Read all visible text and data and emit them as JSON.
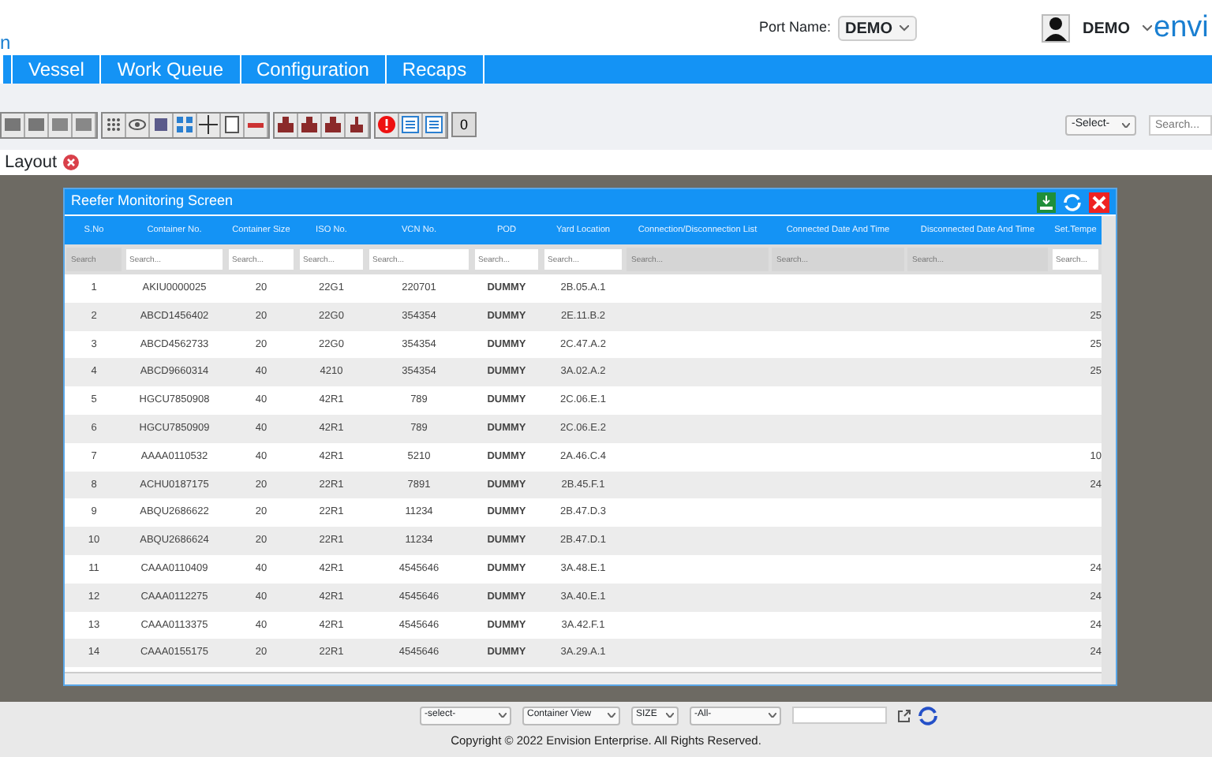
{
  "header": {
    "app_title_fragment": "n",
    "port_label": "Port Name:",
    "port_value": "DEMO",
    "user_name": "DEMO",
    "logo_text": "envi"
  },
  "nav": {
    "items": [
      {
        "label": "Vessel",
        "selected": false
      },
      {
        "label": "Work Queue",
        "selected": false
      },
      {
        "label": "Configuration",
        "selected": false
      },
      {
        "label": "Recaps",
        "selected": false
      }
    ]
  },
  "toolbar": {
    "count": "0",
    "select_value": "-Select-",
    "search_placeholder": "Search..."
  },
  "layout_tab": {
    "label": "Layout"
  },
  "reefer_window": {
    "title": "Reefer Monitoring Screen",
    "columns": [
      "S.No",
      "Container No.",
      "Container Size",
      "ISO No.",
      "VCN No.",
      "POD",
      "Yard Location",
      "Connection/Disconnection List",
      "Connected Date And Time",
      "Disconnected Date And Time",
      "Set.Tempe"
    ],
    "filter_placeholders": [
      "Search",
      "Search...",
      "Search...",
      "Search...",
      "Search...",
      "Search...",
      "Search...",
      "Search...",
      "Search...",
      "Search...",
      "Search..."
    ],
    "rows": [
      [
        "1",
        "AKIU0000025",
        "20",
        "22G1",
        "220701",
        "DUMMY",
        "2B.05.A.1",
        "",
        "",
        "",
        ""
      ],
      [
        "2",
        "ABCD1456402",
        "20",
        "22G0",
        "354354",
        "DUMMY",
        "2E.11.B.2",
        "",
        "",
        "",
        "25"
      ],
      [
        "3",
        "ABCD4562733",
        "20",
        "22G0",
        "354354",
        "DUMMY",
        "2C.47.A.2",
        "",
        "",
        "",
        "25"
      ],
      [
        "4",
        "ABCD9660314",
        "40",
        "4210",
        "354354",
        "DUMMY",
        "3A.02.A.2",
        "",
        "",
        "",
        "25"
      ],
      [
        "5",
        "HGCU7850908",
        "40",
        "42R1",
        "789",
        "DUMMY",
        "2C.06.E.1",
        "",
        "",
        "",
        ""
      ],
      [
        "6",
        "HGCU7850909",
        "40",
        "42R1",
        "789",
        "DUMMY",
        "2C.06.E.2",
        "",
        "",
        "",
        ""
      ],
      [
        "7",
        "AAAA0110532",
        "40",
        "42R1",
        "5210",
        "DUMMY",
        "2A.46.C.4",
        "",
        "",
        "",
        "10"
      ],
      [
        "8",
        "ACHU0187175",
        "20",
        "22R1",
        "7891",
        "DUMMY",
        "2B.45.F.1",
        "",
        "",
        "",
        "24"
      ],
      [
        "9",
        "ABQU2686622",
        "20",
        "22R1",
        "11234",
        "DUMMY",
        "2B.47.D.3",
        "",
        "",
        "",
        ""
      ],
      [
        "10",
        "ABQU2686624",
        "20",
        "22R1",
        "11234",
        "DUMMY",
        "2B.47.D.1",
        "",
        "",
        "",
        ""
      ],
      [
        "11",
        "CAAA0110409",
        "40",
        "42R1",
        "4545646",
        "DUMMY",
        "3A.48.E.1",
        "",
        "",
        "",
        "24"
      ],
      [
        "12",
        "CAAA0112275",
        "40",
        "42R1",
        "4545646",
        "DUMMY",
        "3A.40.E.1",
        "",
        "",
        "",
        "24"
      ],
      [
        "13",
        "CAAA0113375",
        "40",
        "42R1",
        "4545646",
        "DUMMY",
        "3A.42.F.1",
        "",
        "",
        "",
        "24"
      ],
      [
        "14",
        "CAAA0155175",
        "20",
        "22R1",
        "4545646",
        "DUMMY",
        "3A.29.A.1",
        "",
        "",
        "",
        "24"
      ]
    ]
  },
  "bottom_bar": {
    "selects": [
      "-select-",
      "Container View",
      "SIZE",
      "-All-"
    ]
  },
  "footer": {
    "text": "Copyright © 2022 Envision Enterprise. All Rights Reserved."
  }
}
